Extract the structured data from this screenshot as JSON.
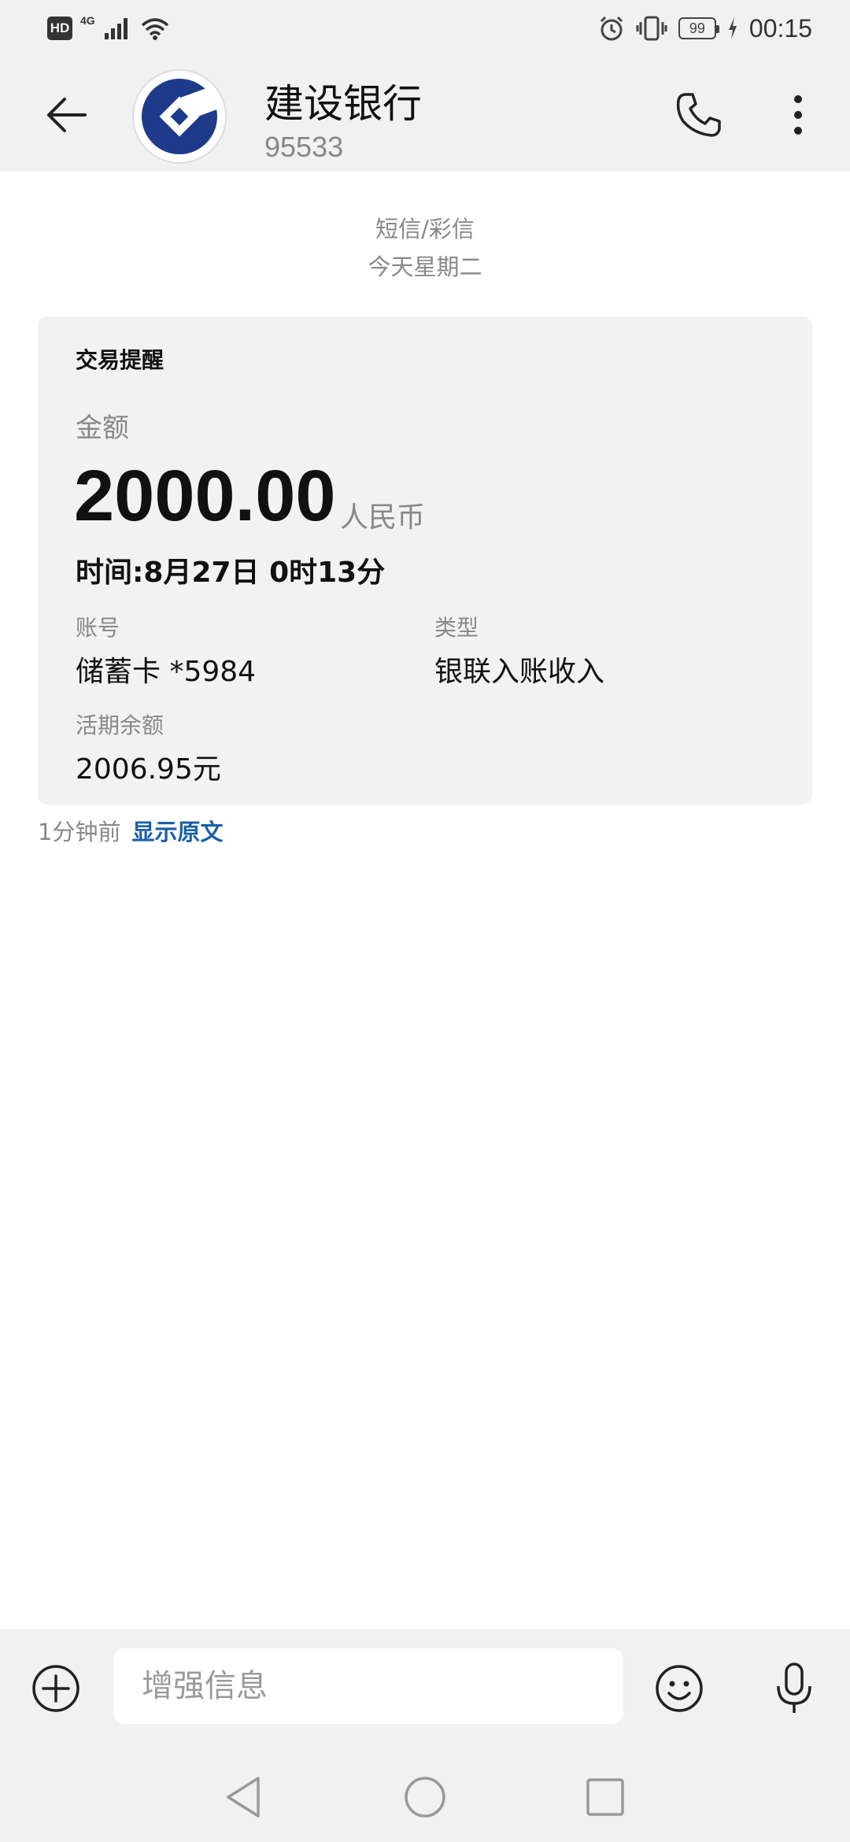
{
  "status_bar": {
    "hd": "HD",
    "network": "4G",
    "battery": "99",
    "time": "00:15"
  },
  "header": {
    "contact_name": "建设银行",
    "contact_number": "95533",
    "brand_color": "#1e3a8a"
  },
  "conversation": {
    "type": "短信/彩信",
    "date": "今天星期二"
  },
  "message": {
    "title": "交易提醒",
    "amount_label": "金额",
    "amount": "2000.00",
    "currency": "人民币",
    "time": "时间:8月27日 0时13分",
    "account_label": "账号",
    "account_value": "储蓄卡 *5984",
    "type_label": "类型",
    "type_value": "银联入账收入",
    "balance_label": "活期余额",
    "balance_value": "2006.95元",
    "sent_time": "1分钟前",
    "show_original": "显示原文"
  },
  "input_bar": {
    "placeholder": "增强信息"
  },
  "colors": {
    "link": "#1a5fa8",
    "bar_bg": "#f1f1f1",
    "card_bg": "#f2f2f2"
  }
}
